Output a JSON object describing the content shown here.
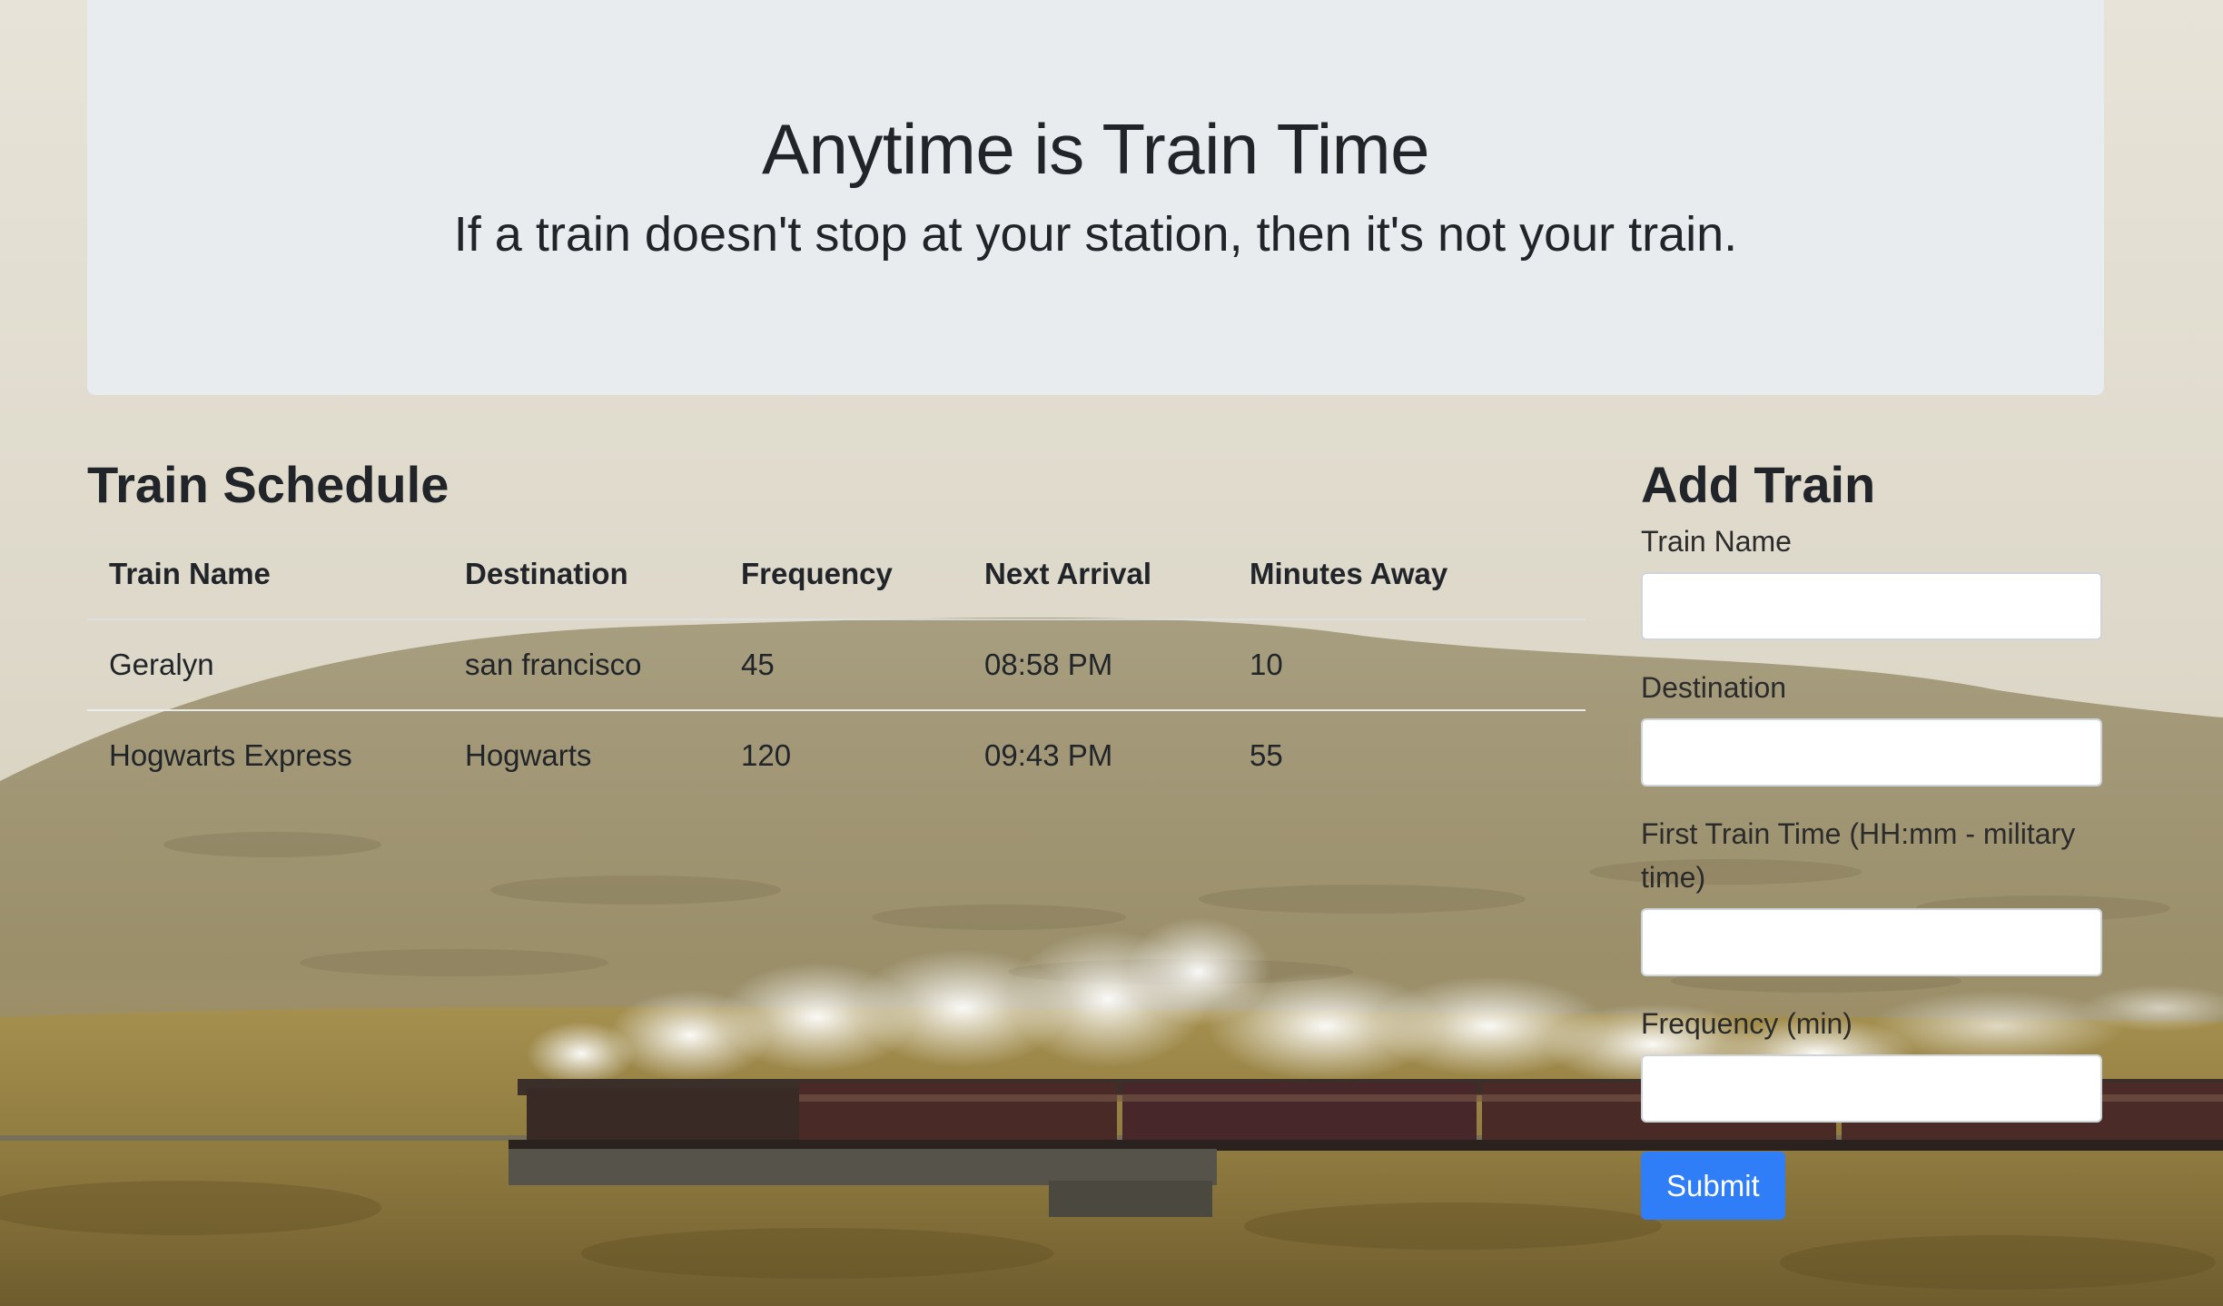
{
  "header": {
    "title": "Anytime is Train Time",
    "subtitle": "If a train doesn't stop at your station, then it's not your train."
  },
  "schedule": {
    "heading": "Train Schedule",
    "columns": [
      "Train Name",
      "Destination",
      "Frequency",
      "Next Arrival",
      "Minutes Away"
    ],
    "rows": [
      [
        "Geralyn",
        "san francisco",
        "45",
        "08:58 PM",
        "10"
      ],
      [
        "Hogwarts Express",
        "Hogwarts",
        "120",
        "09:43 PM",
        "55"
      ]
    ]
  },
  "form": {
    "heading": "Add Train",
    "fields": [
      {
        "label": "Train Name",
        "value": ""
      },
      {
        "label": "Destination",
        "value": ""
      },
      {
        "label": "First Train Time (HH:mm - military time)",
        "value": ""
      },
      {
        "label": "Frequency (min)",
        "value": ""
      }
    ],
    "submit_label": "Submit"
  },
  "colors": {
    "jumbotron_bg": "#e9ecef",
    "submit_button": "#2f7ef7",
    "text": "#212529"
  },
  "background": {
    "icon": "steam-train-landscape-photo"
  }
}
